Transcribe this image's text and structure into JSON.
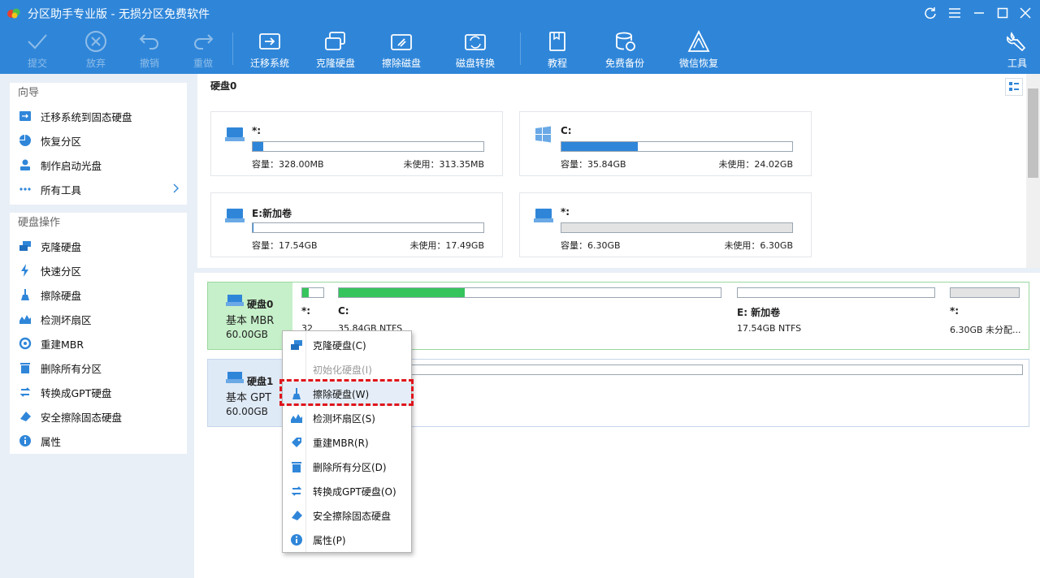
{
  "window": {
    "title": "分区助手专业版 - 无损分区免费软件"
  },
  "toolbar": {
    "commit": "提交",
    "discard": "放弃",
    "undo": "撤销",
    "redo": "重做",
    "migrate_os": "迁移系统",
    "clone_disk": "克隆硬盘",
    "wipe_disk": "擦除磁盘",
    "disk_convert": "磁盘转换",
    "tutorial": "教程",
    "free_backup": "免费备份",
    "wechat_recover": "微信恢复",
    "tools": "工具"
  },
  "sidebar": {
    "wizard_title": "向导",
    "wizard_items": [
      "迁移系统到固态硬盘",
      "恢复分区",
      "制作启动光盘",
      "所有工具"
    ],
    "disk_ops_title": "硬盘操作",
    "disk_ops_items": [
      "克隆硬盘",
      "快速分区",
      "擦除硬盘",
      "检测坏扇区",
      "重建MBR",
      "删除所有分区",
      "转换成GPT硬盘",
      "安全擦除固态硬盘",
      "属性"
    ]
  },
  "upper": {
    "disk_title": "硬盘0",
    "partitions": [
      {
        "name": "*:",
        "capacity": "容量：328.00MB",
        "free": "未使用：313.35MB",
        "used_fraction": 0.045
      },
      {
        "name": "C:",
        "capacity": "容量：35.84GB",
        "free": "未使用：24.02GB",
        "used_fraction": 0.33
      },
      {
        "name": "E:新加卷",
        "capacity": "容量：17.54GB",
        "free": "未使用：17.49GB",
        "used_fraction": 0.003
      },
      {
        "name": "*:",
        "capacity": "容量：6.30GB",
        "free": "未使用：6.30GB",
        "used_fraction": 0.0
      }
    ]
  },
  "lower": {
    "disk0": {
      "name": "硬盘0",
      "type": "基本 MBR",
      "size": "60.00GB"
    },
    "disk0_segments": [
      {
        "name": "*:",
        "desc": "32",
        "used_fraction": 0.3
      },
      {
        "name": "C:",
        "desc": "35.84GB NTFS",
        "used_fraction": 0.33
      },
      {
        "name": "E: 新加卷",
        "desc": "17.54GB NTFS",
        "used_fraction": 0.0
      },
      {
        "name": "*:",
        "desc": "6.30GB 未分配...",
        "used_fraction": 0.0
      }
    ],
    "disk1": {
      "name": "硬盘1",
      "type": "基本 GPT",
      "size": "60.00GB"
    }
  },
  "context_menu": {
    "items": [
      "克隆硬盘(C)",
      "初始化硬盘(I)",
      "擦除硬盘(W)",
      "检测坏扇区(S)",
      "重建MBR(R)",
      "删除所有分区(D)",
      "转换成GPT硬盘(O)",
      "安全擦除固态硬盘",
      "属性(P)"
    ]
  },
  "colors": {
    "accent": "#2f86d9",
    "used_green": "#36c45c",
    "highlight": "#e0141c"
  }
}
